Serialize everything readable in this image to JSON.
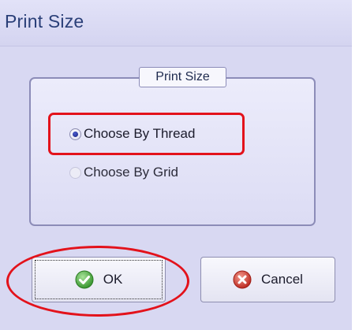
{
  "window": {
    "title": "Print Size"
  },
  "group": {
    "legend": "Print Size"
  },
  "options": [
    {
      "label": "Choose By Thread",
      "checked": true,
      "enabled": true
    },
    {
      "label": "Choose By Grid",
      "checked": false,
      "enabled": false
    }
  ],
  "buttons": {
    "ok_label": "OK",
    "cancel_label": "Cancel"
  },
  "icons": {
    "ok": "checkmark-icon",
    "cancel": "close-icon"
  },
  "colors": {
    "annotation": "#e3121b",
    "title_text": "#2a3f78",
    "ok_icon": "#4caf3c",
    "cancel_icon": "#d8352a"
  }
}
